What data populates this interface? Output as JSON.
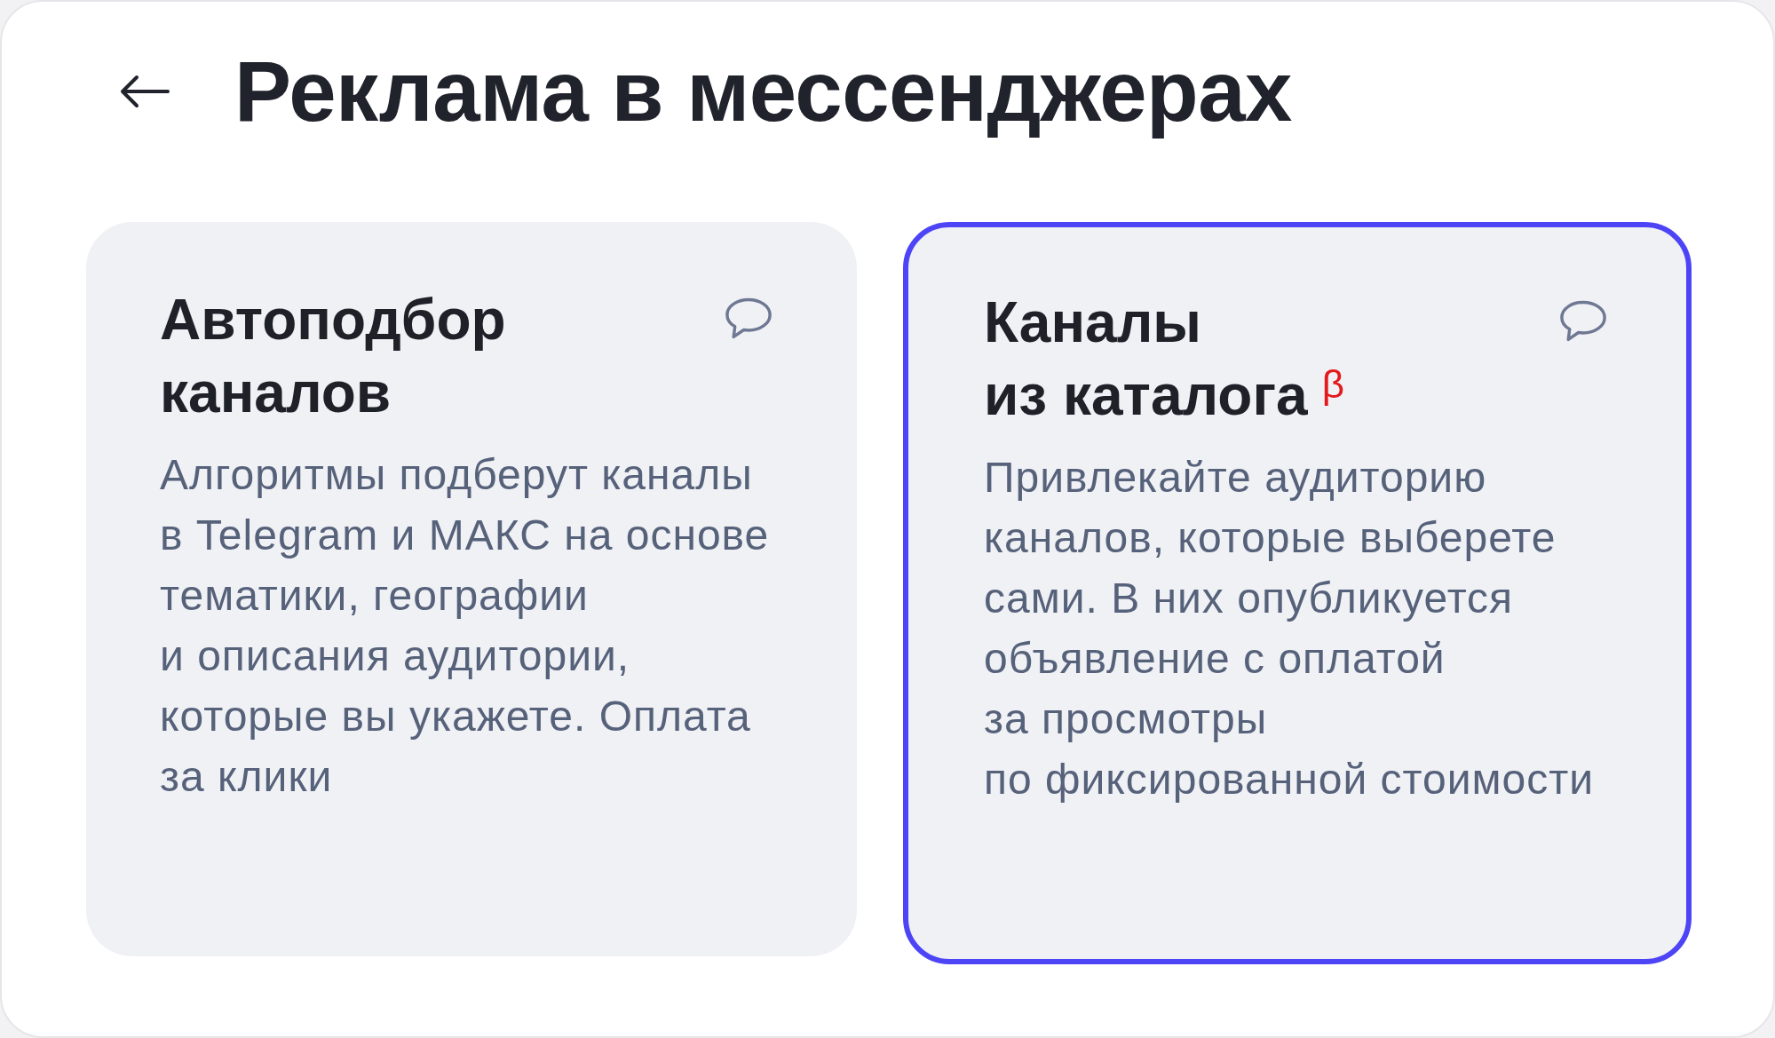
{
  "header": {
    "title": "Реклама в мессенджерах"
  },
  "cards": [
    {
      "title": "Автоподбор\nканалов",
      "description": "Алгоритмы подберут каналы\nв Telegram и МАКС на основе\nтематики, географии\nи описания аудитории,\nкоторые вы укажете. Оплата\nза клики",
      "selected": false
    },
    {
      "title": "Каналы\nиз каталога",
      "badge": "β",
      "description": "Привлекайте аудиторию\nканалов, которые выберете\nсами. В них опубликуется\nобъявление с оплатой\nза просмотры\nпо фиксированной стоимости",
      "selected": true
    }
  ]
}
